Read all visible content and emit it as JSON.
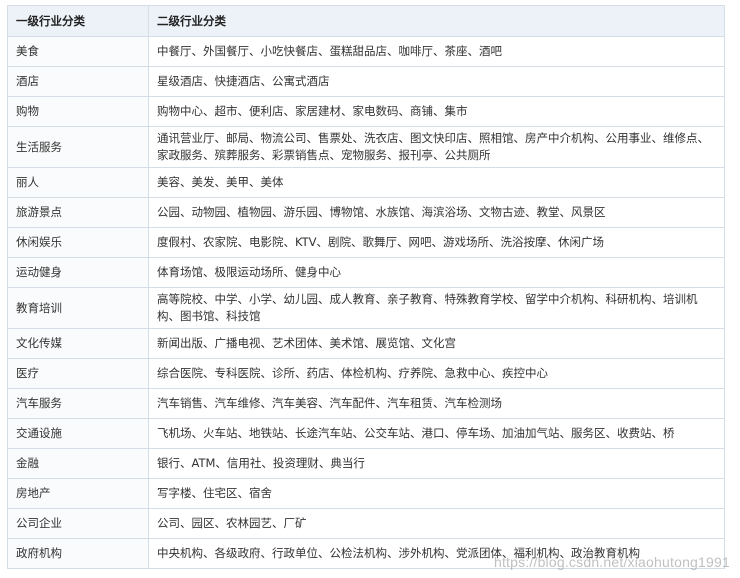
{
  "table": {
    "headers": [
      "一级行业分类",
      "二级行业分类"
    ],
    "rows": [
      {
        "level1": "美食",
        "level2": "中餐厅、外国餐厅、小吃快餐店、蛋糕甜品店、咖啡厅、茶座、酒吧"
      },
      {
        "level1": "酒店",
        "level2": "星级酒店、快捷酒店、公寓式酒店"
      },
      {
        "level1": "购物",
        "level2": "购物中心、超市、便利店、家居建材、家电数码、商铺、集市"
      },
      {
        "level1": "生活服务",
        "level2": "通讯营业厅、邮局、物流公司、售票处、洗衣店、图文快印店、照相馆、房产中介机构、公用事业、维修点、家政服务、殡葬服务、彩票销售点、宠物服务、报刊亭、公共厕所"
      },
      {
        "level1": "丽人",
        "level2": "美容、美发、美甲、美体"
      },
      {
        "level1": "旅游景点",
        "level2": "公园、动物园、植物园、游乐园、博物馆、水族馆、海滨浴场、文物古迹、教堂、风景区"
      },
      {
        "level1": "休闲娱乐",
        "level2": "度假村、农家院、电影院、KTV、剧院、歌舞厅、网吧、游戏场所、洗浴按摩、休闲广场"
      },
      {
        "level1": "运动健身",
        "level2": "体育场馆、极限运动场所、健身中心"
      },
      {
        "level1": "教育培训",
        "level2": "高等院校、中学、小学、幼儿园、成人教育、亲子教育、特殊教育学校、留学中介机构、科研机构、培训机构、图书馆、科技馆"
      },
      {
        "level1": "文化传媒",
        "level2": "新闻出版、广播电视、艺术团体、美术馆、展览馆、文化宫"
      },
      {
        "level1": "医疗",
        "level2": "综合医院、专科医院、诊所、药店、体检机构、疗养院、急救中心、疾控中心"
      },
      {
        "level1": "汽车服务",
        "level2": "汽车销售、汽车维修、汽车美容、汽车配件、汽车租赁、汽车检测场"
      },
      {
        "level1": "交通设施",
        "level2": "飞机场、火车站、地铁站、长途汽车站、公交车站、港口、停车场、加油加气站、服务区、收费站、桥"
      },
      {
        "level1": "金融",
        "level2": "银行、ATM、信用社、投资理财、典当行"
      },
      {
        "level1": "房地产",
        "level2": "写字楼、住宅区、宿舍"
      },
      {
        "level1": "公司企业",
        "level2": "公司、园区、农林园艺、厂矿"
      },
      {
        "level1": "政府机构",
        "level2": "中央机构、各级政府、行政单位、公检法机构、涉外机构、党派团体、福利机构、政治教育机构"
      }
    ]
  },
  "watermark": "https://blog.csdn.net/xiaohutong1991"
}
